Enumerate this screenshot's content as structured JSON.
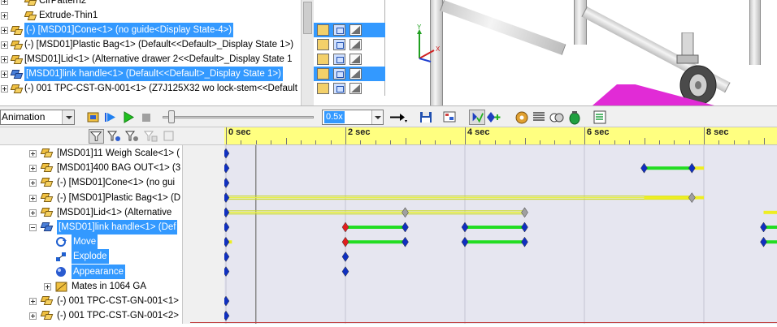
{
  "top_tree": {
    "items": [
      {
        "label": "CirPattern2",
        "selected": false,
        "icon": "pattern-icon"
      },
      {
        "label": "Extrude-Thin1",
        "selected": false,
        "icon": "extrude-icon"
      },
      {
        "label": "(-) [MSD01]Cone<1> (no guide<Display State-4>)",
        "selected": true,
        "icon": "part-icon"
      },
      {
        "label": "(-) [MSD01]Plastic Bag<1> (Default<<Default>_Display State 1>)",
        "selected": false,
        "icon": "part-icon"
      },
      {
        "label": "[MSD01]Lid<1> (Alternative drawer 2<<Default>_Display State 1",
        "selected": false,
        "icon": "part-icon"
      },
      {
        "label": "[MSD01]link handle<1> (Default<<Default>_Display State 1>)",
        "selected": true,
        "icon": "part-icon"
      },
      {
        "label": "(-) 001 TPC-CST-GN-001<1> (Z7J125X32 wo lock-stem<<Default",
        "selected": false,
        "icon": "part-icon"
      }
    ]
  },
  "toolbar": {
    "study_type": "Animation",
    "speed": "0.5x",
    "buttons": [
      "calculate-icon",
      "play-from-start-icon",
      "play-icon",
      "stop-icon",
      "playback-mode-icon",
      "save-animation-icon",
      "animation-wizard-icon",
      "autokey-icon",
      "add-key-icon",
      "motor-icon",
      "spring-icon",
      "contact-icon",
      "gravity-icon",
      "results-icon"
    ]
  },
  "filter_bar": {
    "buttons": [
      "filter-animated-icon",
      "filter-driving-icon",
      "filter-selected-icon",
      "filter-results-icon"
    ]
  },
  "motion_tree": {
    "items": [
      {
        "label": "[MSD01]11 Weigh Scale<1> (",
        "indent": 0,
        "expander": "plus",
        "selected": false
      },
      {
        "label": "[MSD01]400 BAG OUT<1> (3",
        "indent": 0,
        "expander": "plus",
        "selected": false
      },
      {
        "label": "(-) [MSD01]Cone<1> (no gui",
        "indent": 0,
        "expander": "plus",
        "selected": false
      },
      {
        "label": "(-) [MSD01]Plastic Bag<1> (D",
        "indent": 0,
        "expander": "plus",
        "selected": false
      },
      {
        "label": "[MSD01]Lid<1> (Alternative",
        "indent": 0,
        "expander": "plus",
        "selected": false
      },
      {
        "label": "[MSD01]link handle<1> (Def",
        "indent": 0,
        "expander": "minus",
        "selected": true
      },
      {
        "label": "Move",
        "indent": 1,
        "expander": "",
        "selected": true
      },
      {
        "label": "Explode",
        "indent": 1,
        "expander": "",
        "selected": true
      },
      {
        "label": "Appearance",
        "indent": 1,
        "expander": "",
        "selected": true
      },
      {
        "label": "Mates in 1064 GA",
        "indent": 1,
        "expander": "plus",
        "selected": false
      },
      {
        "label": "(-) 001 TPC-CST-GN-001<1>",
        "indent": 0,
        "expander": "plus",
        "selected": false
      },
      {
        "label": "(-) 001 TPC-CST-GN-001<2>",
        "indent": 0,
        "expander": "plus",
        "selected": false
      }
    ]
  },
  "timeline": {
    "time_labels": [
      "0 sec",
      "2 sec",
      "4 sec",
      "6 sec",
      "8 sec"
    ],
    "current_time_sec": 0.5,
    "colors": {
      "key_blue": "#1030c0",
      "key_gray": "#a0a0a0",
      "key_red": "#e02020",
      "bar_green": "#22dd22",
      "bar_yellow": "#eeee22"
    },
    "tracks": [
      {
        "keys": [
          {
            "t": 0,
            "c": "blue"
          }
        ],
        "bars": []
      },
      {
        "keys": [
          {
            "t": 0,
            "c": "blue"
          },
          {
            "t": 7,
            "c": "blue"
          },
          {
            "t": 7.8,
            "c": "blue"
          }
        ],
        "bars": [
          {
            "from": 7,
            "to": 7.8,
            "c": "green"
          },
          {
            "from": 7.8,
            "to": 8,
            "c": "yellow"
          }
        ]
      },
      {
        "keys": [
          {
            "t": 0,
            "c": "blue"
          }
        ],
        "bars": []
      },
      {
        "keys": [
          {
            "t": 0,
            "c": "blue"
          },
          {
            "t": 7.8,
            "c": "gray"
          }
        ],
        "bars": [
          {
            "from": 0,
            "to": 7.8,
            "c": "yellowline"
          },
          {
            "from": 7,
            "to": 8,
            "c": "yellow"
          }
        ]
      },
      {
        "keys": [
          {
            "t": 0,
            "c": "blue"
          },
          {
            "t": 3,
            "c": "gray"
          },
          {
            "t": 5,
            "c": "gray"
          }
        ],
        "bars": [
          {
            "from": 0,
            "to": 5,
            "c": "yellowline"
          },
          {
            "from": 9,
            "to": 9.3,
            "c": "yellow"
          }
        ]
      },
      {
        "keys": [
          {
            "t": 0,
            "c": "blue"
          },
          {
            "t": 2,
            "c": "red"
          },
          {
            "t": 3,
            "c": "blue"
          },
          {
            "t": 4,
            "c": "blue"
          },
          {
            "t": 5,
            "c": "blue"
          },
          {
            "t": 9,
            "c": "blue"
          }
        ],
        "bars": [
          {
            "from": 2,
            "to": 3,
            "c": "green"
          },
          {
            "from": 4,
            "to": 5,
            "c": "green"
          },
          {
            "from": 9,
            "to": 9.3,
            "c": "green"
          }
        ]
      },
      {
        "keys": [
          {
            "t": 0,
            "c": "blue"
          },
          {
            "t": 2,
            "c": "red"
          },
          {
            "t": 3,
            "c": "blue"
          },
          {
            "t": 4,
            "c": "blue"
          },
          {
            "t": 5,
            "c": "blue"
          },
          {
            "t": 9,
            "c": "blue"
          }
        ],
        "bars": [
          {
            "from": 0,
            "to": 0.1,
            "c": "yellow"
          },
          {
            "from": 2,
            "to": 3,
            "c": "green"
          },
          {
            "from": 4,
            "to": 5,
            "c": "green"
          },
          {
            "from": 9,
            "to": 9.3,
            "c": "green"
          }
        ]
      },
      {
        "keys": [
          {
            "t": 0,
            "c": "blue"
          },
          {
            "t": 2,
            "c": "blue"
          }
        ],
        "bars": []
      },
      {
        "keys": [
          {
            "t": 0,
            "c": "blue"
          },
          {
            "t": 2,
            "c": "blue"
          }
        ],
        "bars": []
      },
      {
        "keys": [],
        "bars": []
      },
      {
        "keys": [
          {
            "t": 0,
            "c": "blue"
          }
        ],
        "bars": []
      },
      {
        "keys": [
          {
            "t": 0,
            "c": "blue"
          }
        ],
        "bars": []
      }
    ]
  }
}
